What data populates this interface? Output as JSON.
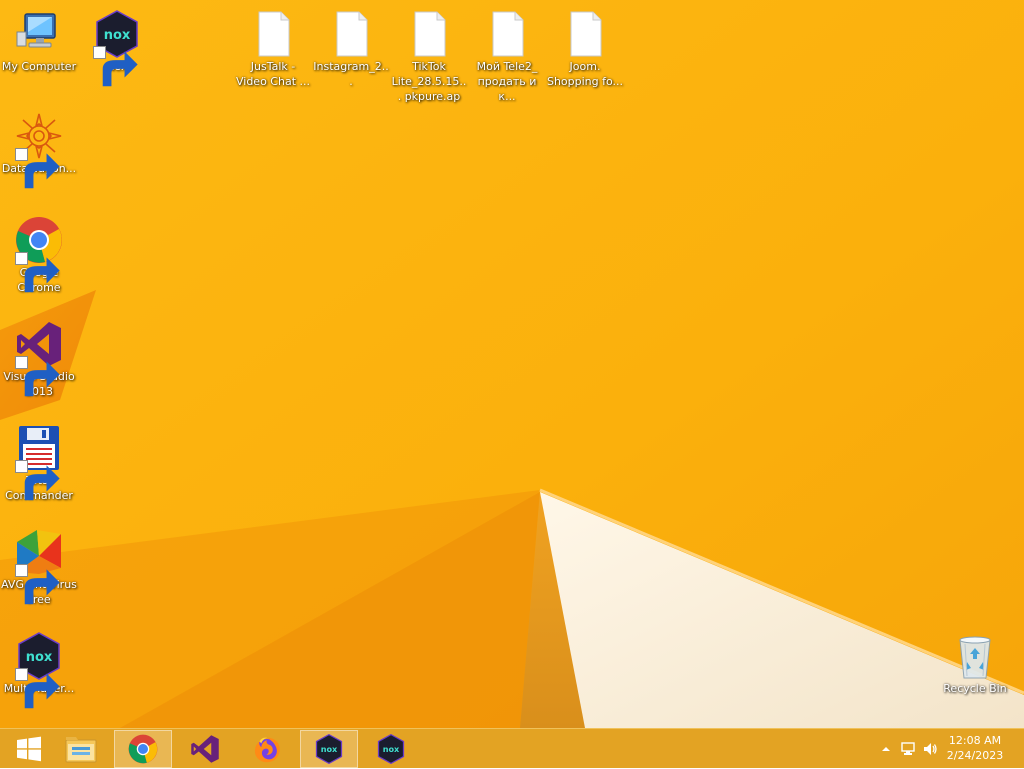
{
  "desktop": {
    "background_color": "#fbb40a",
    "icons": [
      {
        "label": "My Computer",
        "icon": "my-computer-icon"
      },
      {
        "label": "Nox",
        "icon": "nox-icon"
      },
      {
        "label": "JusTalk - Video Chat ...",
        "icon": "file-icon"
      },
      {
        "label": "Instagram_2...",
        "icon": "file-icon"
      },
      {
        "label": "TikTok Lite_28.5.15... pkpure.ap",
        "icon": "file-icon"
      },
      {
        "label": "Мой Tele2_ продать и к...",
        "icon": "file-icon"
      },
      {
        "label": "Joom. Shopping fo...",
        "icon": "file-icon"
      },
      {
        "label": "DataWagon...",
        "icon": "datawagon-icon"
      },
      {
        "label": "Google Chrome",
        "icon": "chrome-icon"
      },
      {
        "label": "Visual Studio 2013",
        "icon": "visual-studio-icon"
      },
      {
        "label": "Total Commander",
        "icon": "total-commander-icon"
      },
      {
        "label": "AVG AntiVirus Free",
        "icon": "avg-antivirus-icon"
      },
      {
        "label": "MultiPlayer...",
        "icon": "nox-multiplayer-icon"
      },
      {
        "label": "Recycle Bin",
        "icon": "recycle-bin-icon"
      }
    ]
  },
  "taskbar": {
    "color": "#e3a323",
    "buttons": [
      {
        "name": "start-button",
        "icon": "windows-logo-icon"
      },
      {
        "name": "file-explorer-button",
        "icon": "file-explorer-icon"
      },
      {
        "name": "chrome-taskbar-button",
        "icon": "chrome-icon",
        "active": true
      },
      {
        "name": "visual-studio-taskbar-button",
        "icon": "visual-studio-icon"
      },
      {
        "name": "firefox-taskbar-button",
        "icon": "firefox-icon"
      },
      {
        "name": "nox-taskbar-button",
        "icon": "nox-icon",
        "active": true
      },
      {
        "name": "nox-multiplayer-taskbar-button",
        "icon": "nox-multiplayer-icon"
      }
    ],
    "tray": {
      "icons": [
        "show-hidden-icons-icon",
        "network-icon",
        "volume-icon"
      ],
      "time": "12:08 AM",
      "date": "2/24/2023"
    }
  }
}
